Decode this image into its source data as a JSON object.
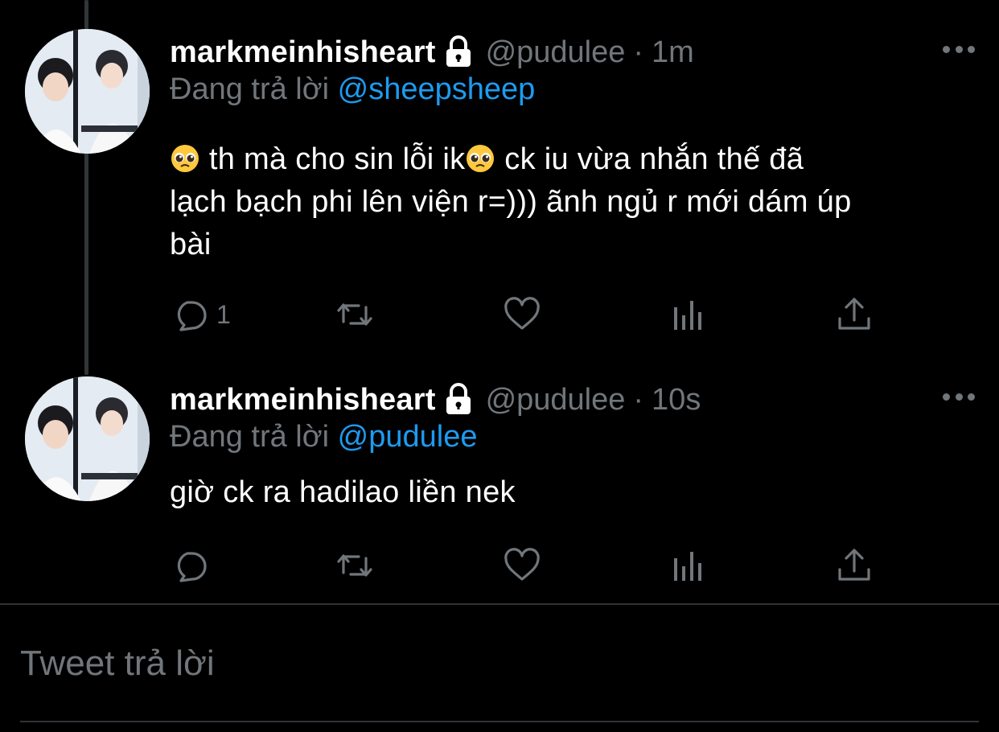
{
  "thread": [
    {
      "display_name": "markmeinhisheart",
      "handle": "@pudulee",
      "separator": "·",
      "time": "1m",
      "reply_prefix": "Đang trả lời",
      "reply_to": "@sheepsheep",
      "text_line1": " th mà cho sin lỗi ik",
      "text_line1b": " ck iu vừa nhắn thế đã",
      "text_line2": "lạch bạch phi lên viện r=))) ãnh ngủ r mới dám úp",
      "text_line3": "bài",
      "emojis": [
        "pleading-face-emoji",
        "pleading-face-emoji"
      ],
      "reply_count": "1",
      "icons": [
        "reply-icon",
        "retweet-icon",
        "like-icon",
        "analytics-icon",
        "share-icon"
      ]
    },
    {
      "display_name": "markmeinhisheart",
      "handle": "@pudulee",
      "separator": "·",
      "time": "10s",
      "reply_prefix": "Đang trả lời",
      "reply_to": "@pudulee",
      "text_line1": "giờ ck ra hadilao liền nek",
      "reply_count": "",
      "icons": [
        "reply-icon",
        "retweet-icon",
        "like-icon",
        "analytics-icon",
        "share-icon"
      ]
    }
  ],
  "compose": {
    "placeholder": "Tweet trả lời"
  },
  "colors": {
    "background": "#000000",
    "text": "#ffffff",
    "muted": "#71767b",
    "accent": "#1d9bf0",
    "divider": "#2f3336"
  }
}
